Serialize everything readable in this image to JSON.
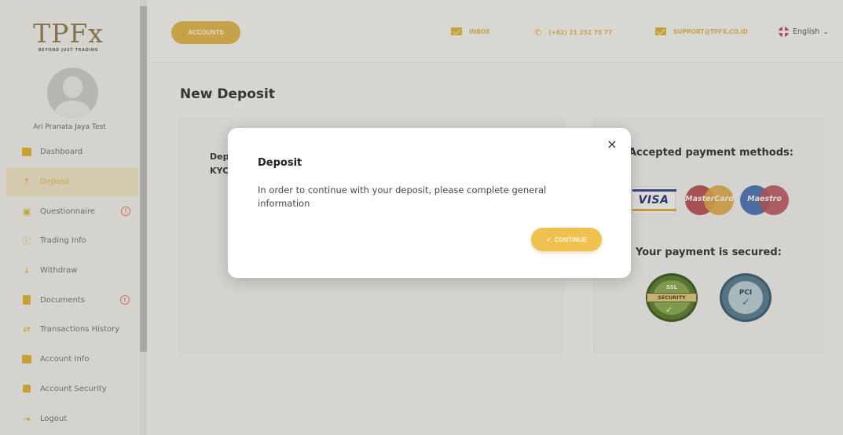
{
  "brand": {
    "logo_text": "TPFx",
    "tagline": "BEYOND JUST TRADING"
  },
  "user": {
    "name": "Ari Pranata Jaya Test"
  },
  "sidebar": {
    "items": [
      {
        "label": "Dashboard",
        "icon": "dashboard-icon"
      },
      {
        "label": "Deposit",
        "icon": "arrow-up-icon",
        "active": true
      },
      {
        "label": "Questionnaire",
        "icon": "clipboard-icon",
        "alert": "!"
      },
      {
        "label": "Trading Info",
        "icon": "info-icon"
      },
      {
        "label": "Withdraw",
        "icon": "arrow-down-icon"
      },
      {
        "label": "Documents",
        "icon": "document-icon",
        "alert": "!"
      },
      {
        "label": "Transactions History",
        "icon": "swap-arrows-icon"
      },
      {
        "label": "Account Info",
        "icon": "id-card-icon"
      },
      {
        "label": "Account Security",
        "icon": "lock-icon"
      },
      {
        "label": "Logout",
        "icon": "logout-icon"
      }
    ]
  },
  "topbar": {
    "accounts_label": "ACCOUNTS",
    "inbox_label": "INBOX",
    "phone_label": "(+62) 21 252 75 77",
    "support_label": "SUPPORT@TPFX.CO.ID",
    "language_label": "English"
  },
  "page": {
    "title": "New Deposit",
    "left_card_text_line1": "Dep",
    "left_card_text_line2": "KYC",
    "payment_methods_title": "Accepted payment methods:",
    "secured_title": "Your payment is secured:",
    "payment_logos": {
      "visa": "VISA",
      "mastercard": "MasterCard",
      "maestro": "Maestro"
    },
    "security_badges": {
      "ssl_top": "SSL",
      "ssl_band": "SECURITY",
      "pci": "PCI"
    }
  },
  "modal": {
    "title": "Deposit",
    "body": "In order to continue with your deposit, please complete general information",
    "close_symbol": "×",
    "continue_label": "CONTINUE"
  },
  "colors": {
    "accent": "#d9ad38",
    "accent_button": "#efc14f",
    "alert": "#e07b5a",
    "background": "#eceae6",
    "modal_bg": "#ffffff"
  }
}
